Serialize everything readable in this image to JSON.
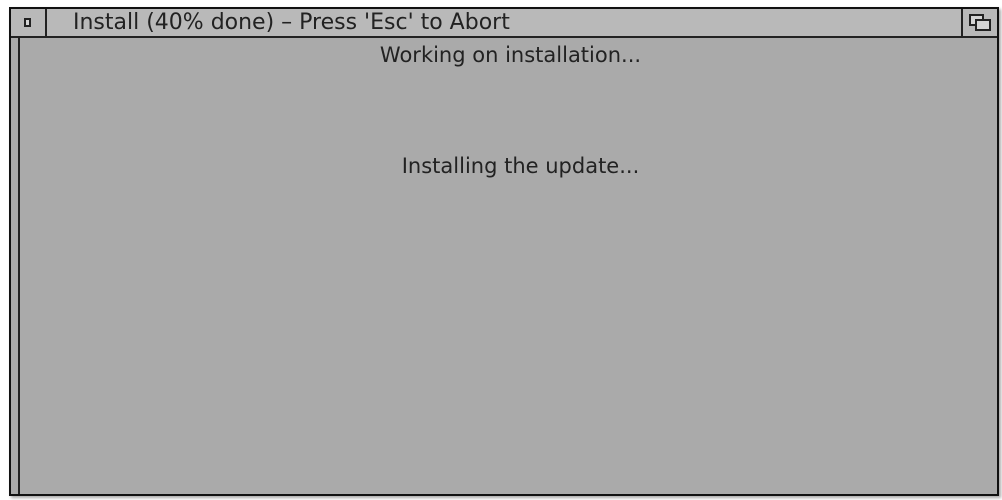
{
  "window": {
    "title": "Install (40% done) – Press 'Esc' to Abort",
    "progress_percent": 40,
    "abort_key": "Esc",
    "close_icon": "close-box-icon",
    "zoom_icon": "window-toggle-icon"
  },
  "content": {
    "heading": "Working on installation...",
    "message": "Installing the update..."
  },
  "colors": {
    "window_background": "#aaaaaa",
    "titlebar_background": "#b9b9b9",
    "text": "#222222",
    "border": "#111111"
  }
}
